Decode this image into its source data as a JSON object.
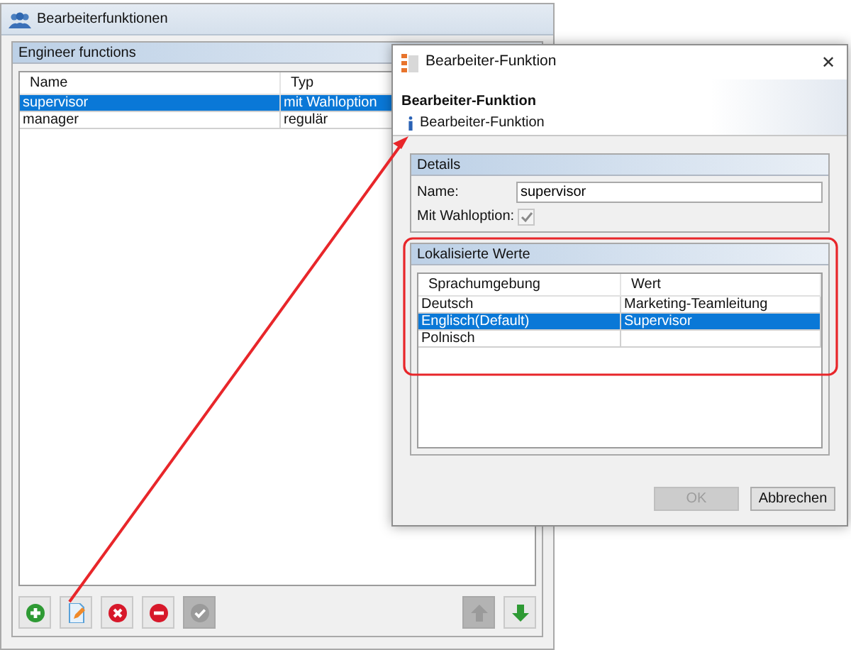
{
  "main_window": {
    "title": "Bearbeiterfunktionen",
    "panel_title": "Engineer functions",
    "table": {
      "columns": [
        "Name",
        "Typ"
      ],
      "rows": [
        {
          "cells": [
            "supervisor",
            "mit Wahloption"
          ],
          "selected": true
        },
        {
          "cells": [
            "manager",
            "regulär"
          ],
          "selected": false
        }
      ]
    },
    "toolbar": [
      {
        "kind": "add",
        "disabled": false
      },
      {
        "kind": "edit",
        "disabled": false
      },
      {
        "kind": "delete",
        "disabled": false
      },
      {
        "kind": "remove",
        "disabled": false
      },
      {
        "kind": "confirm",
        "disabled": true
      },
      {
        "kind": "up",
        "disabled": true
      },
      {
        "kind": "down",
        "disabled": false
      }
    ]
  },
  "dialog": {
    "title": "Bearbeiter-Funktion",
    "close": "✕",
    "header_title": "Bearbeiter-Funktion",
    "header_info": "Bearbeiter-Funktion",
    "details": {
      "title": "Details",
      "name_label": "Name:",
      "name_value": "supervisor",
      "option_label": "Mit Wahloption:",
      "option_checked": true,
      "option_disabled": true
    },
    "localized": {
      "title": "Lokalisierte Werte",
      "columns": [
        "Sprachumgebung",
        "Wert"
      ],
      "rows": [
        {
          "cells": [
            "Deutsch",
            "Marketing-Teamleitung"
          ],
          "selected": false
        },
        {
          "cells": [
            "Englisch(Default)",
            "Supervisor"
          ],
          "selected": true
        },
        {
          "cells": [
            "Polnisch",
            ""
          ],
          "selected": false
        }
      ]
    },
    "buttons": [
      {
        "label": "OK",
        "disabled": true
      },
      {
        "label": "Abbrechen",
        "disabled": false
      }
    ]
  },
  "annotations": {
    "highlight_frame": true,
    "arrow": true
  }
}
